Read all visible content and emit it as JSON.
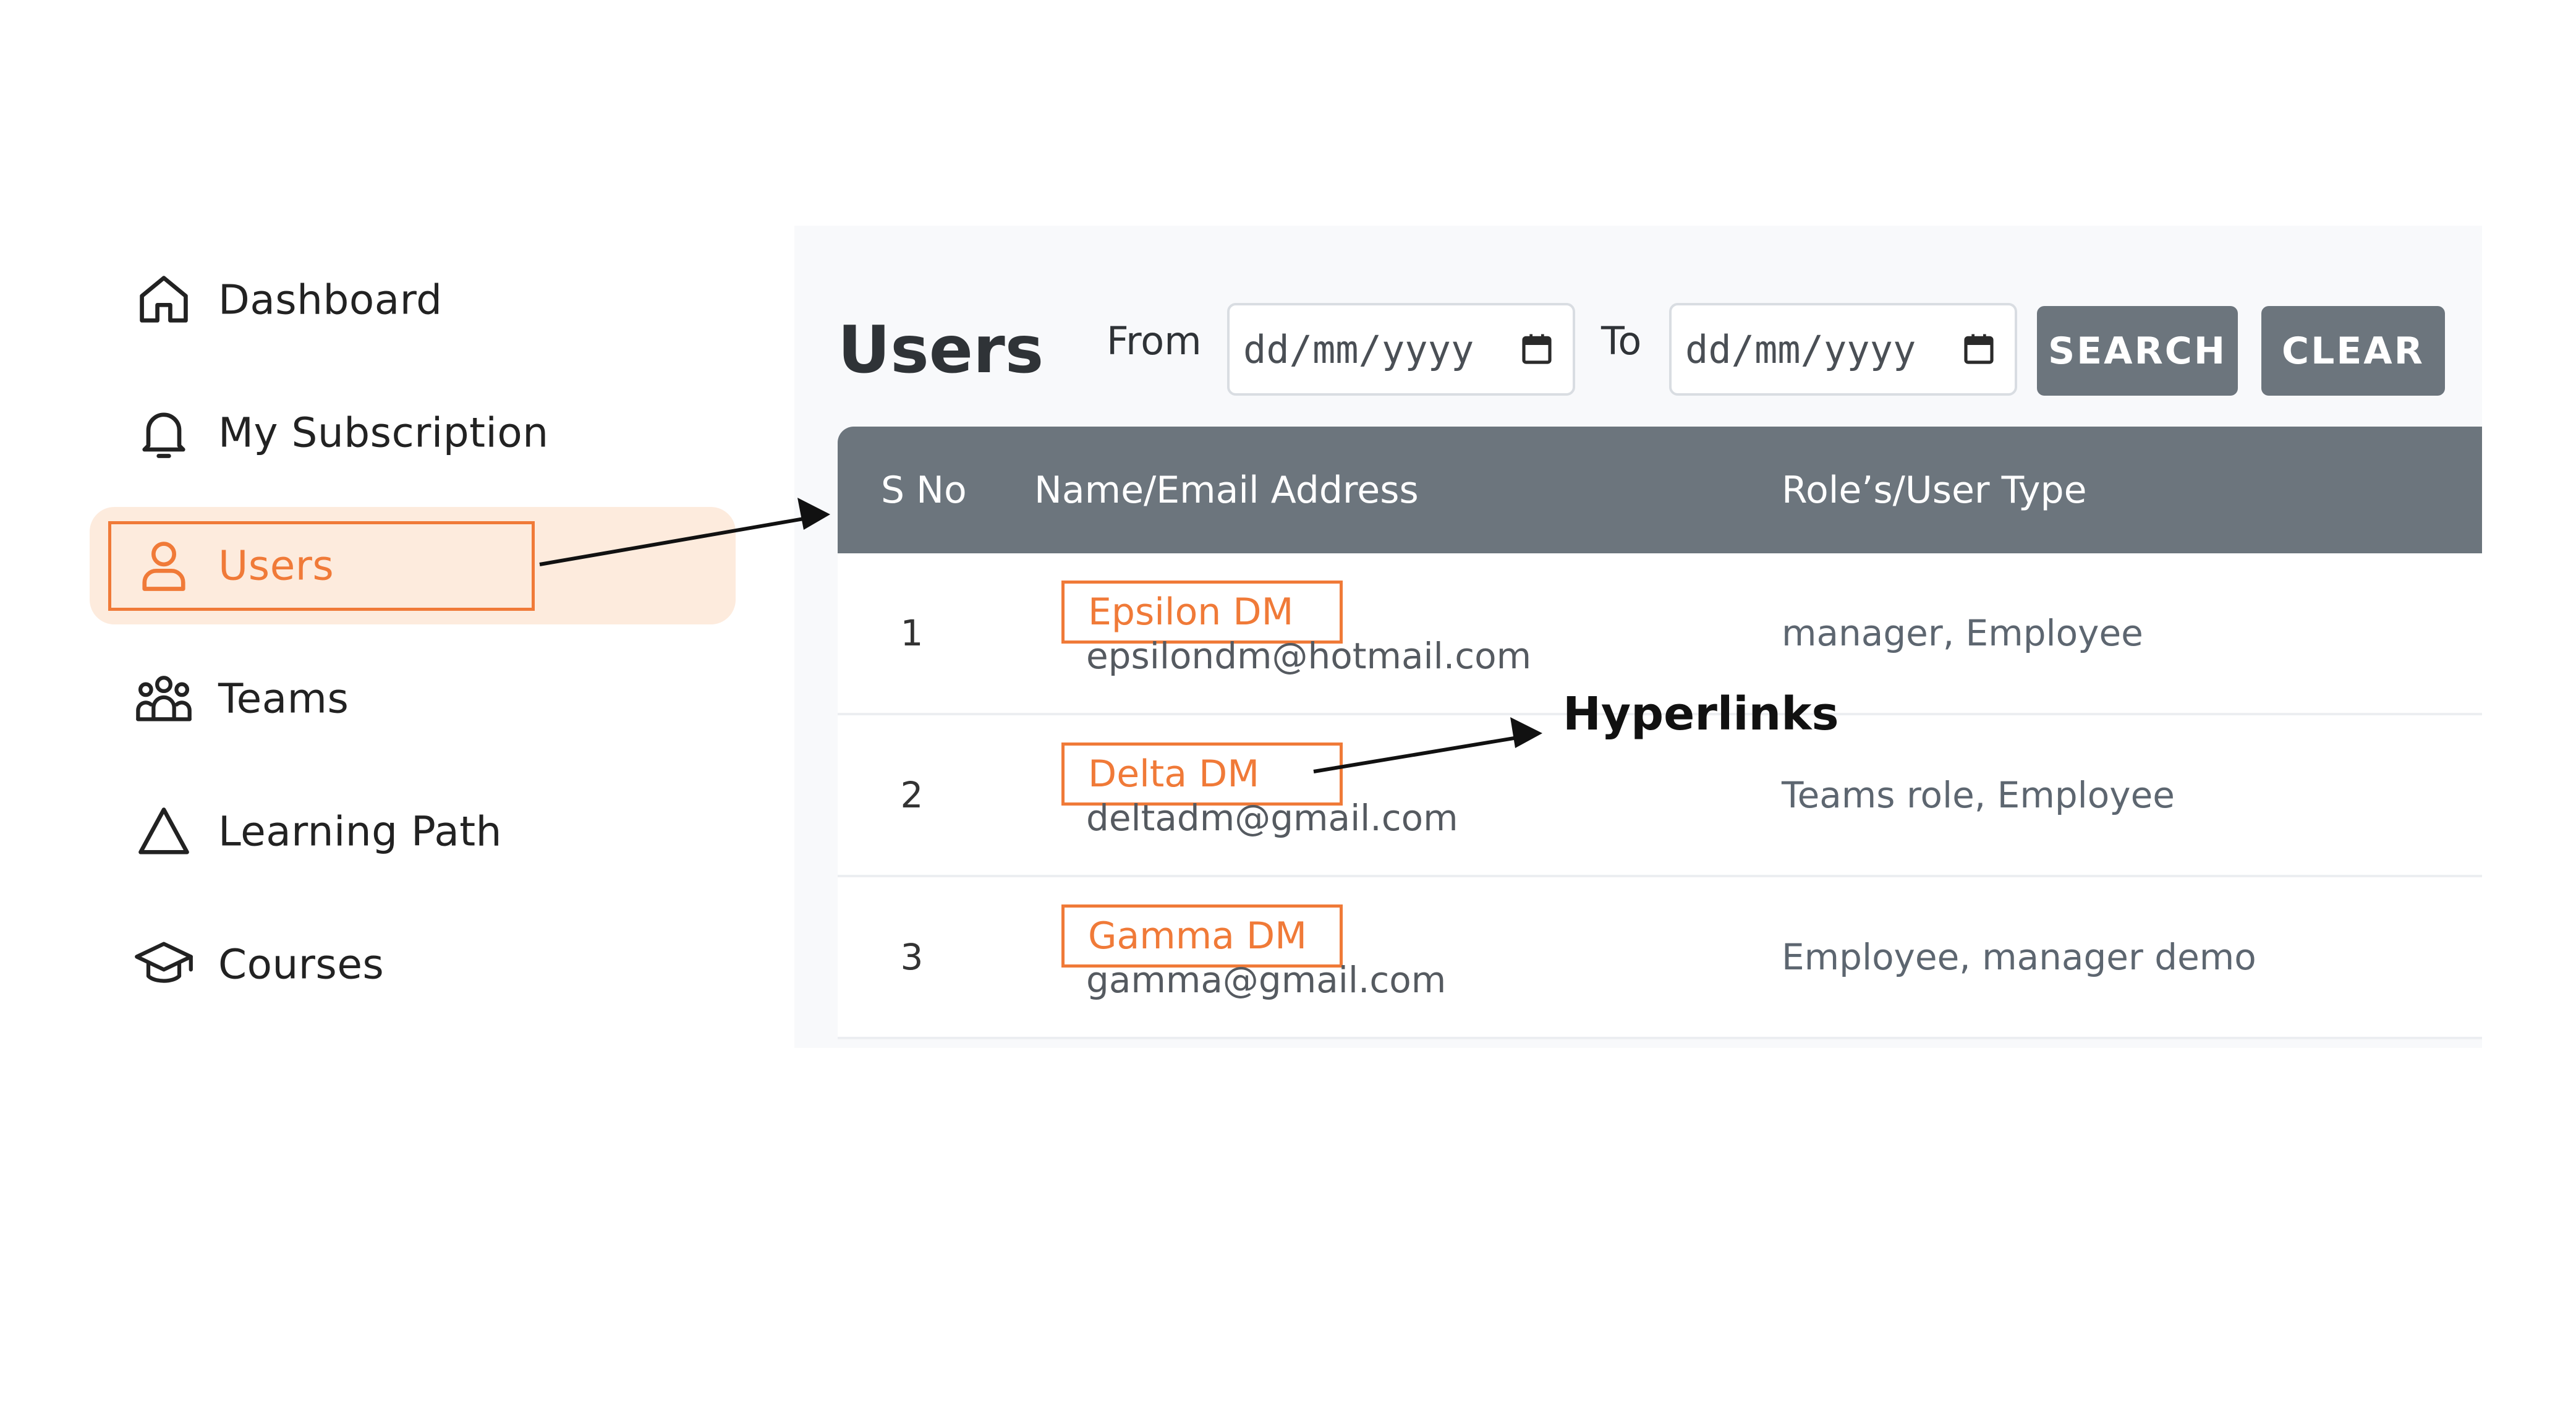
{
  "sidebar": {
    "items": [
      {
        "label": "Dashboard",
        "icon": "home-icon"
      },
      {
        "label": "My Subscription",
        "icon": "bell-icon"
      },
      {
        "label": "Users",
        "icon": "user-icon",
        "active": true
      },
      {
        "label": "Teams",
        "icon": "group-icon"
      },
      {
        "label": "Learning Path",
        "icon": "triangle-icon"
      },
      {
        "label": "Courses",
        "icon": "graduation-cap-icon"
      }
    ]
  },
  "main": {
    "title": "Users",
    "filters": {
      "from_label": "From",
      "from_placeholder": "dd/mm/yyyy",
      "to_label": "To",
      "to_placeholder": "dd/mm/yyyy",
      "search_label": "SEARCH",
      "clear_label": "CLEAR"
    },
    "table": {
      "columns": [
        "S No",
        "Name/Email Address",
        "Role’s/User Type"
      ],
      "rows": [
        {
          "sno": "1",
          "name": "Epsilon DM",
          "email": "epsilondm@hotmail.com",
          "roles": "manager, Employee"
        },
        {
          "sno": "2",
          "name": "Delta DM",
          "email": "deltadm@gmail.com",
          "roles": "Teams role, Employee"
        },
        {
          "sno": "3",
          "name": "Gamma DM",
          "email": "gamma@gmail.com",
          "roles": "Employee, manager demo"
        }
      ]
    }
  },
  "annotation": {
    "label": "Hyperlinks"
  },
  "colors": {
    "accent": "#f07a38",
    "active_bg": "#fdebdd",
    "header_bg": "#6c757d",
    "button_bg": "#6c757d"
  }
}
